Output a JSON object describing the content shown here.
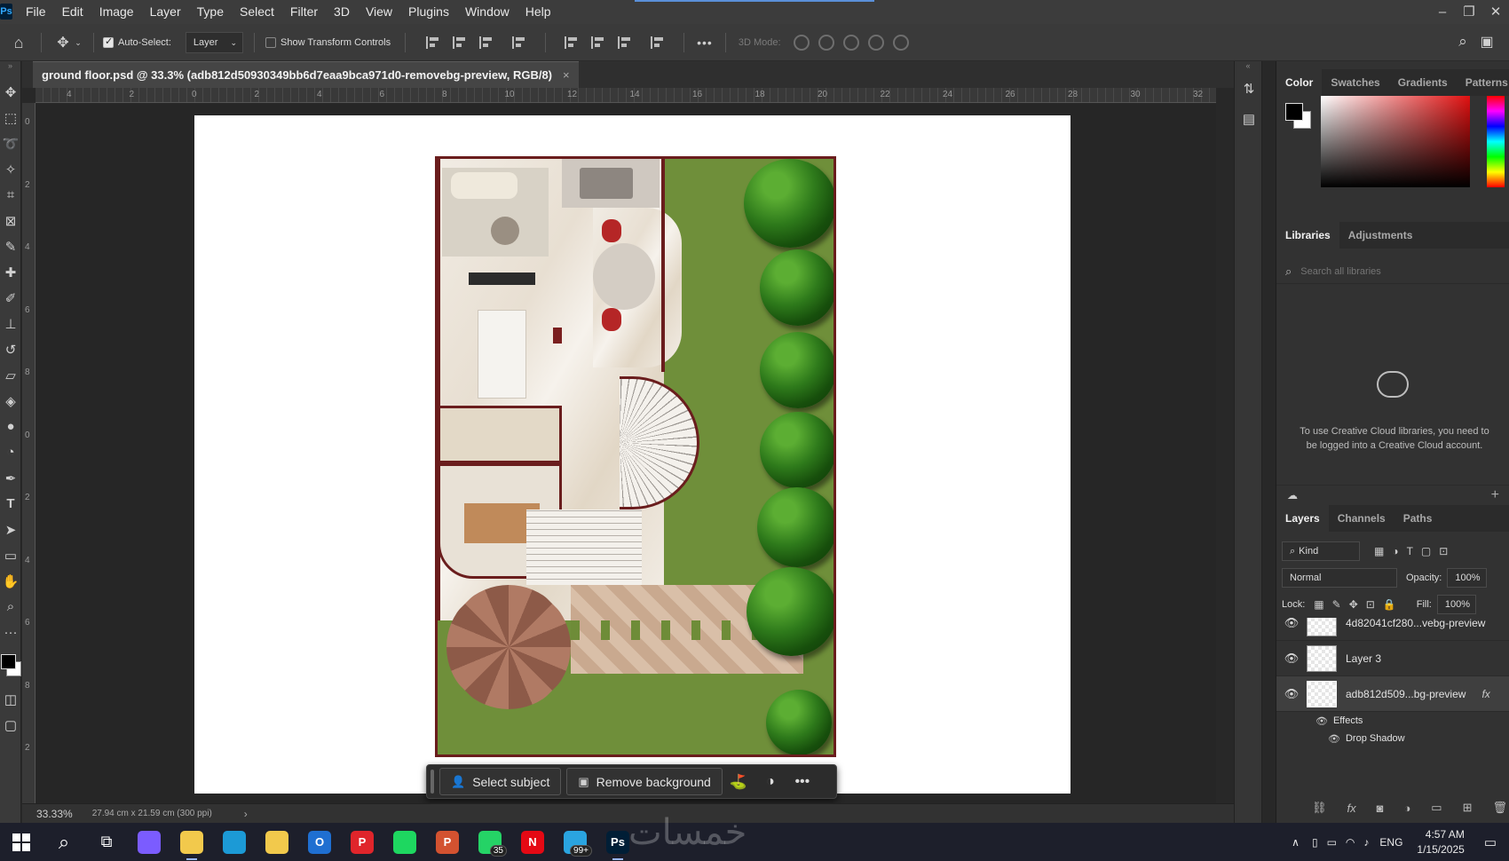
{
  "app": {
    "logo": "Ps"
  },
  "menu": [
    "File",
    "Edit",
    "Image",
    "Layer",
    "Type",
    "Select",
    "Filter",
    "3D",
    "View",
    "Plugins",
    "Window",
    "Help"
  ],
  "window_controls": [
    "minimize-icon",
    "restore-icon",
    "close-icon"
  ],
  "options_bar": {
    "auto_select_label": "Auto-Select:",
    "auto_select_checked": true,
    "auto_select_target": "Layer",
    "show_transform_label": "Show Transform Controls",
    "show_transform_checked": false,
    "more": "•••",
    "mode_3d_label": "3D Mode:"
  },
  "document": {
    "tab_title": "ground floor.psd @ 33.3% (adb812d50930349bb6d7eaa9bca971d0-removebg-preview, RGB/8)",
    "close": "×"
  },
  "rulers": {
    "h_ticks": [
      "4",
      "2",
      "0",
      "2",
      "4",
      "6",
      "8",
      "10",
      "12",
      "14",
      "16",
      "18",
      "20",
      "22",
      "24",
      "26",
      "28",
      "30",
      "32"
    ],
    "v_ticks": [
      "0",
      "2",
      "4",
      "6",
      "8",
      "0",
      "2",
      "4",
      "6",
      "8",
      "2"
    ]
  },
  "context_task_bar": {
    "select_subject": "Select subject",
    "remove_background": "Remove background",
    "more": "•••"
  },
  "status_bar": {
    "zoom": "33.33%",
    "doc_info": "27.94 cm x 21.59 cm (300 ppi)",
    "arrow": "›"
  },
  "color_panel": {
    "tabs": [
      "Color",
      "Swatches",
      "Gradients",
      "Patterns"
    ],
    "active_tab": "Color",
    "foreground": "#000000",
    "background": "#ffffff"
  },
  "libraries_panel": {
    "tabs": [
      "Libraries",
      "Adjustments"
    ],
    "search_placeholder": "Search all libraries",
    "message": "To use Creative Cloud libraries, you need to be logged into a Creative Cloud account."
  },
  "layers_panel": {
    "tabs": [
      "Layers",
      "Channels",
      "Paths"
    ],
    "filter_kind": "Kind",
    "blend_mode": "Normal",
    "opacity_label": "Opacity:",
    "opacity_value": "100%",
    "lock_label": "Lock:",
    "fill_label": "Fill:",
    "fill_value": "100%",
    "layers": [
      {
        "name": "4d82041cf280...vebg-preview"
      },
      {
        "name": "Layer 3"
      },
      {
        "name": "adb812d509...bg-preview",
        "fx": "fx"
      }
    ],
    "effects_label": "Effects",
    "drop_shadow_label": "Drop Shadow"
  },
  "taskbar": {
    "apps": [
      {
        "name": "copilot",
        "color": "#7b5cff"
      },
      {
        "name": "file-explorer",
        "color": "#f2c94c"
      },
      {
        "name": "edge",
        "color": "#1c9ad6"
      },
      {
        "name": "store",
        "color": "#f2c94c"
      },
      {
        "name": "outlook",
        "color": "#1f6fd1",
        "label": "O"
      },
      {
        "name": "pinterest",
        "color": "#e0252b",
        "label": "P"
      },
      {
        "name": "spotify",
        "color": "#1ed760"
      },
      {
        "name": "powerpoint",
        "color": "#d35230",
        "label": "P"
      },
      {
        "name": "whatsapp",
        "color": "#25d366",
        "badge": "35"
      },
      {
        "name": "netflix",
        "color": "#e50914",
        "label": "N"
      },
      {
        "name": "telegram",
        "color": "#2aa4e0",
        "badge": "99+"
      },
      {
        "name": "photoshop",
        "color": "#001e36",
        "label": "Ps"
      }
    ],
    "language": "ENG",
    "time": "4:57 AM",
    "date": "1/15/2025"
  },
  "watermark": "خمسات"
}
